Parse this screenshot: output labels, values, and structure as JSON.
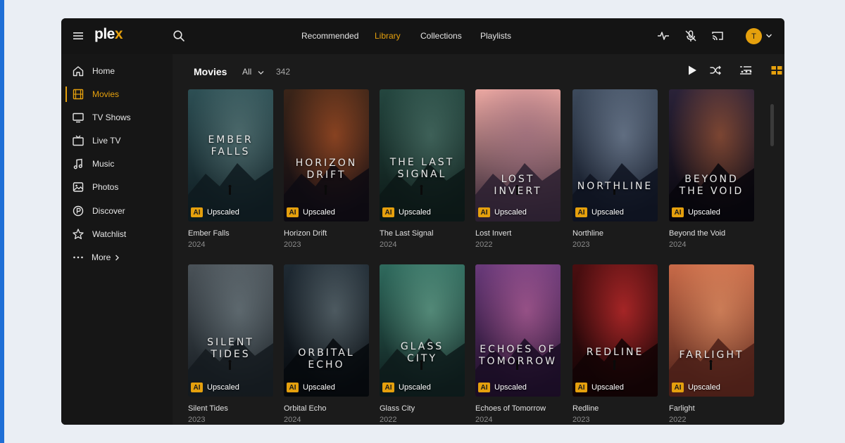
{
  "app": {
    "logo_text": "plex",
    "brand_color": "#e5a00d"
  },
  "topnav": {
    "items": [
      {
        "label": "Recommended",
        "active": false
      },
      {
        "label": "Library",
        "active": true
      },
      {
        "label": "Collections",
        "active": false
      },
      {
        "label": "Playlists",
        "active": false
      }
    ],
    "icons": [
      "activity-icon",
      "mic-off-icon",
      "cast-icon"
    ],
    "avatar_initial": "T"
  },
  "sidebar": {
    "items": [
      {
        "label": "Home",
        "icon": "home-icon",
        "active": false
      },
      {
        "label": "Movies",
        "icon": "film-icon",
        "active": true
      },
      {
        "label": "TV Shows",
        "icon": "tv-icon",
        "active": false
      },
      {
        "label": "Live TV",
        "icon": "live-tv-icon",
        "active": false
      },
      {
        "label": "Music",
        "icon": "music-icon",
        "active": false
      },
      {
        "label": "Photos",
        "icon": "photos-icon",
        "active": false
      },
      {
        "label": "Discover",
        "icon": "discover-icon",
        "active": false
      },
      {
        "label": "Watchlist",
        "icon": "star-icon",
        "active": false
      },
      {
        "label": "More",
        "icon": "more-icon",
        "active": false
      }
    ]
  },
  "library": {
    "title": "Movies",
    "filter": "All",
    "count": "342",
    "toolbar_icons": [
      "play-icon",
      "shuffle-icon",
      "list-view-icon",
      "grid-view-icon",
      "more-options-icon"
    ]
  },
  "badge": {
    "ai": "AI",
    "label": "Upscaled"
  },
  "movies": [
    {
      "title": "Ember Falls",
      "year": "2024",
      "poster_text": "EMBER\nFALLS"
    },
    {
      "title": "Horizon Drift",
      "year": "2023",
      "poster_text": "HORIZON\nDRIFT"
    },
    {
      "title": "The Last Signal",
      "year": "2024",
      "poster_text": "THE LAST\nSIGNAL"
    },
    {
      "title": "Lost Invert",
      "year": "2022",
      "poster_text": "LOST\nINVERT"
    },
    {
      "title": "Northline",
      "year": "2023",
      "poster_text": "NORTHLINE"
    },
    {
      "title": "Beyond the Void",
      "year": "2024",
      "poster_text": "BEYOND\nTHE VOID"
    },
    {
      "title": "Silent Tides",
      "year": "2023",
      "poster_text": "SILENT\nTIDES"
    },
    {
      "title": "Orbital Echo",
      "year": "2024",
      "poster_text": "ORBITAL\nECHO"
    },
    {
      "title": "Glass City",
      "year": "2022",
      "poster_text": "GLASS\nCITY"
    },
    {
      "title": "Echoes of Tomorrow",
      "year": "2024",
      "poster_text": "ECHOES OF\nTOMORROW"
    },
    {
      "title": "Redline",
      "year": "2023",
      "poster_text": "REDLINE"
    },
    {
      "title": "Farlight",
      "year": "2022",
      "poster_text": "FARLIGHT"
    }
  ]
}
